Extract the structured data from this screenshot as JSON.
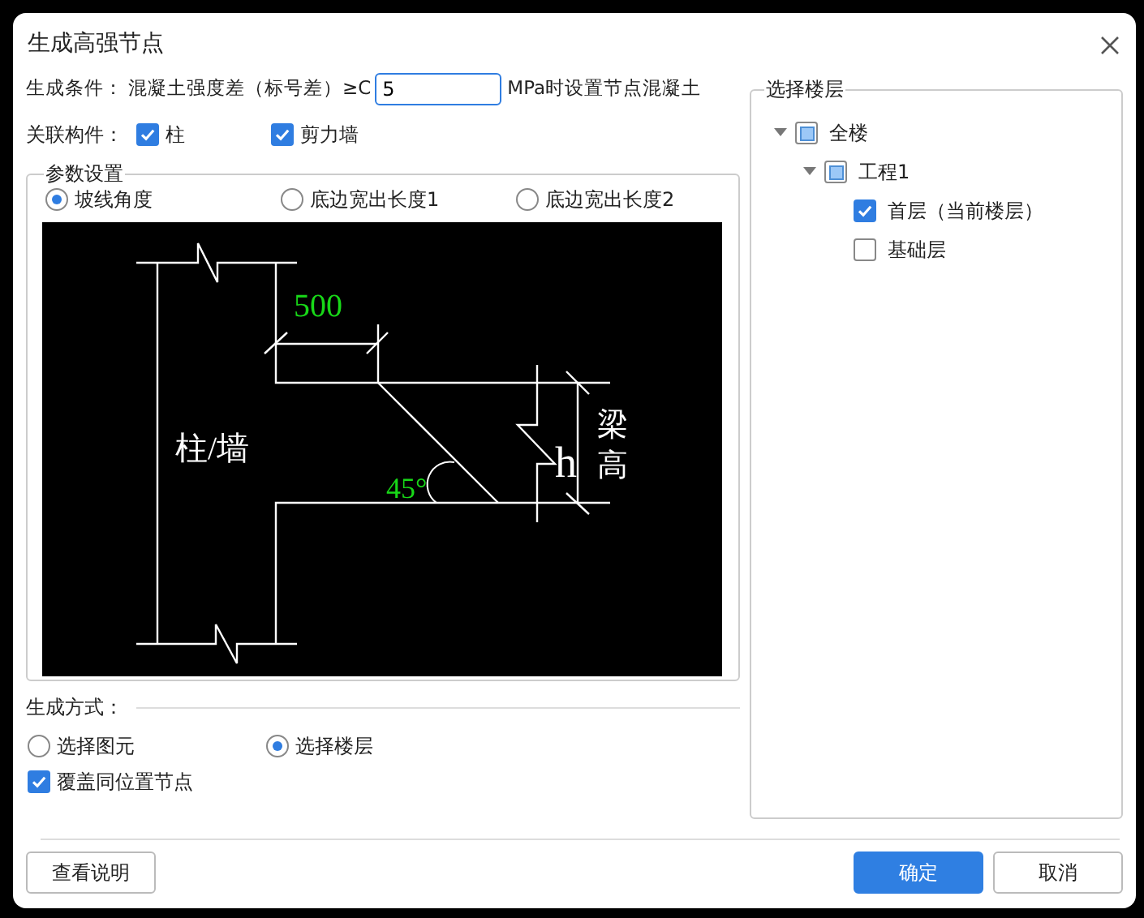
{
  "dialog": {
    "title": "生成高强节点"
  },
  "condition": {
    "label": "生成条件：",
    "text": "混凝土强度差（标号差）≥C",
    "value": "5",
    "suffix": "MPa时设置节点混凝土"
  },
  "related": {
    "label": "关联构件：",
    "options": [
      {
        "label": "柱",
        "checked": true
      },
      {
        "label": "剪力墙",
        "checked": true
      }
    ]
  },
  "params": {
    "title": "参数设置",
    "options": [
      {
        "label": "坡线角度",
        "selected": true
      },
      {
        "label": "底边宽出长度1",
        "selected": false
      },
      {
        "label": "底边宽出长度2",
        "selected": false
      }
    ],
    "diagram": {
      "dimension": "500",
      "angle": "45°",
      "member": "柱/墙",
      "height_symbol": "h",
      "height_label": "梁高"
    }
  },
  "method": {
    "title": "生成方式：",
    "options": [
      {
        "label": "选择图元",
        "selected": false
      },
      {
        "label": "选择楼层",
        "selected": true
      }
    ],
    "override": {
      "label": "覆盖同位置节点",
      "checked": true
    }
  },
  "floors": {
    "title": "选择楼层",
    "tree": [
      {
        "label": "全楼",
        "indeterminate": true,
        "expanded": true,
        "children": [
          {
            "label": "工程1",
            "indeterminate": true,
            "expanded": true,
            "children": [
              {
                "label": "首层（当前楼层）",
                "checked": true
              },
              {
                "label": "基础层",
                "checked": false
              }
            ]
          }
        ]
      }
    ]
  },
  "buttons": {
    "help": "查看说明",
    "ok": "确定",
    "cancel": "取消"
  }
}
